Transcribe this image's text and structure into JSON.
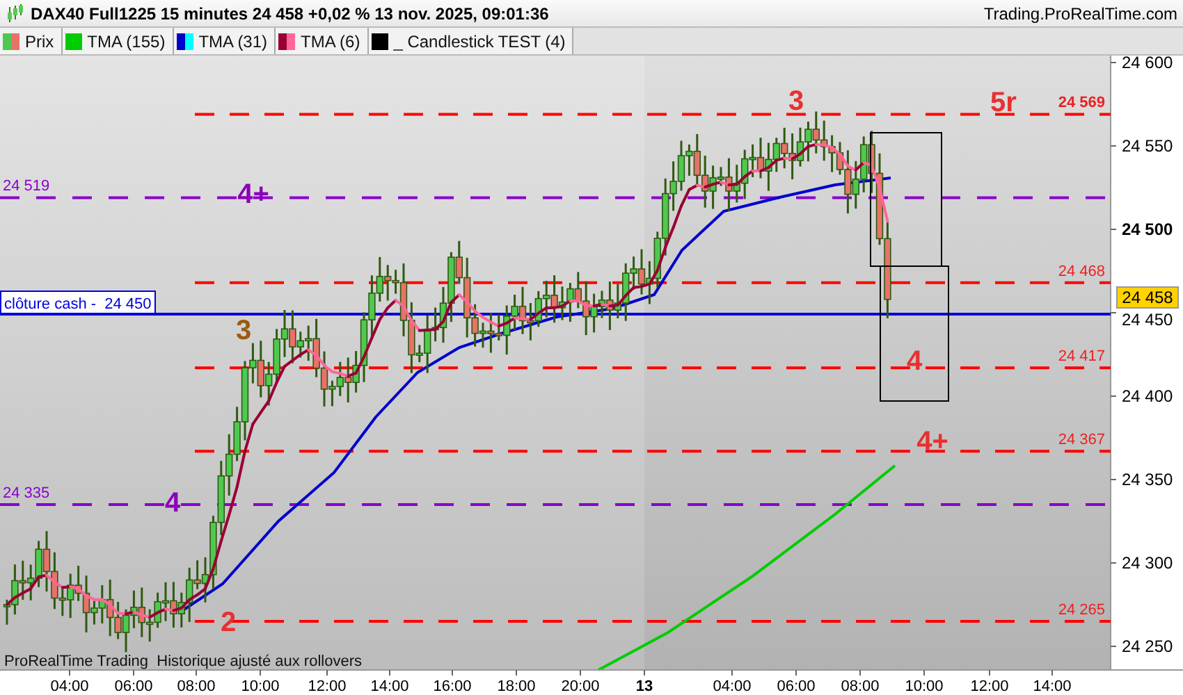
{
  "header": {
    "title": "DAX40 Full1225 15 minutes 24 458 +0,02 % 13 nov. 2025, 09:01:36",
    "site": "Trading.ProRealTime.com"
  },
  "legend": {
    "items": [
      {
        "label": "Prix",
        "swatch": [
          {
            "color": "#4fc84f"
          },
          {
            "color": "#e8716a"
          }
        ]
      },
      {
        "label": "TMA (155)",
        "swatch": [
          {
            "color": "#00cc00"
          }
        ]
      },
      {
        "label": "TMA (31)",
        "swatch": [
          {
            "color": "#0000cc"
          },
          {
            "color": "#00ffff"
          }
        ]
      },
      {
        "label": "TMA (6)",
        "swatch": [
          {
            "color": "#990033"
          },
          {
            "color": "#ff6699"
          }
        ]
      },
      {
        "label": "_ Candlestick TEST (4)",
        "swatch": [
          {
            "color": "#000000"
          }
        ]
      }
    ]
  },
  "chart": {
    "levels": [
      {
        "kind": "target",
        "label": "24 569"
      },
      {
        "kind": "pivot",
        "label": "24 519"
      },
      {
        "kind": "target",
        "label": "24 468"
      },
      {
        "kind": "target",
        "label": "24 417"
      },
      {
        "kind": "target",
        "label": "24 367"
      },
      {
        "kind": "pivot",
        "label": "24 335"
      },
      {
        "kind": "target",
        "label": "24 265"
      }
    ],
    "close_line": {
      "label": "clôture cash -  24 450"
    },
    "annotations": [
      {
        "text": "3",
        "color": "#e83030"
      },
      {
        "text": "5r",
        "color": "#e83030"
      },
      {
        "text": "4+",
        "color": "#8a00b8"
      },
      {
        "text": "3",
        "color": "#9a5a10"
      },
      {
        "text": "4",
        "color": "#e83030"
      },
      {
        "text": "4+",
        "color": "#e83030"
      },
      {
        "text": "4",
        "color": "#8a00b8"
      },
      {
        "text": "2",
        "color": "#e83030"
      }
    ],
    "footer": "ProRealTime Trading  Historique ajusté aux rollovers",
    "current_price": "24 458"
  },
  "y_axis": {
    "ticks": [
      "24 600",
      "24 550",
      "24 500",
      "24 450",
      "24 400",
      "24 350",
      "24 300",
      "24 250"
    ]
  },
  "x_axis": {
    "ticks": [
      "04:00",
      "06:00",
      "08:00",
      "10:00",
      "12:00",
      "14:00",
      "16:00",
      "18:00",
      "20:00",
      "13",
      "04:00",
      "06:00",
      "08:00",
      "10:00",
      "12:00",
      "14:00"
    ]
  }
}
